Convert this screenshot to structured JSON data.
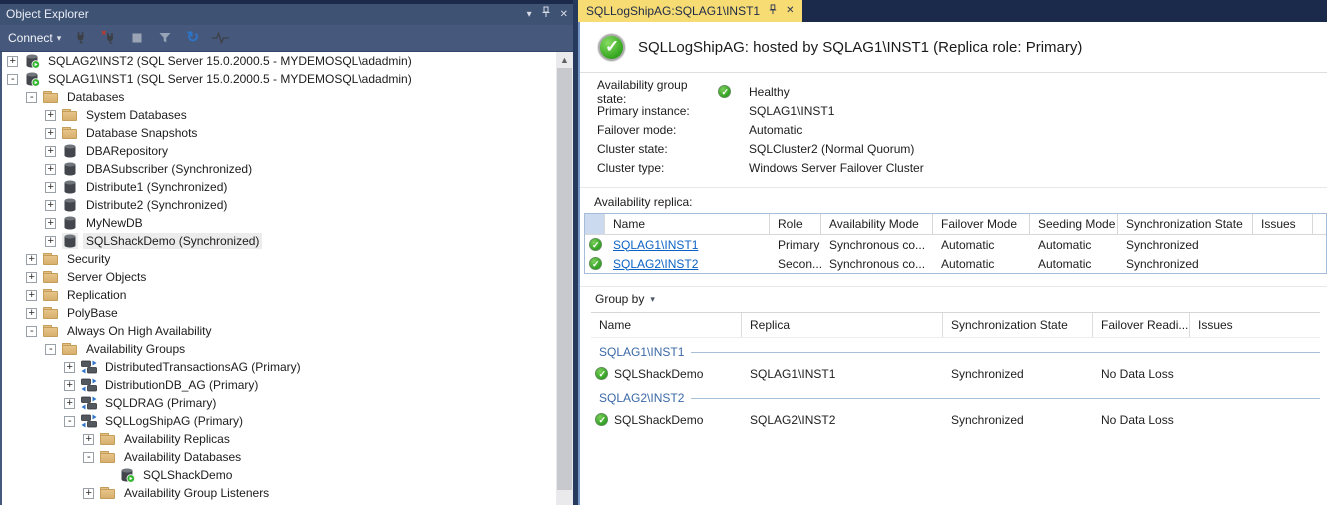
{
  "object_explorer": {
    "title": "Object Explorer",
    "connect_label": "Connect",
    "tree": [
      {
        "label": "SQLAG2\\INST2 (SQL Server 15.0.2000.5 - MYDEMOSQL\\adadmin)"
      },
      {
        "label": "SQLAG1\\INST1 (SQL Server 15.0.2000.5 - MYDEMOSQL\\adadmin)"
      },
      {
        "label": "Databases"
      },
      {
        "label": "System Databases"
      },
      {
        "label": "Database Snapshots"
      },
      {
        "label": "DBARepository"
      },
      {
        "label": "DBASubscriber (Synchronized)"
      },
      {
        "label": "Distribute1 (Synchronized)"
      },
      {
        "label": "Distribute2 (Synchronized)"
      },
      {
        "label": "MyNewDB"
      },
      {
        "label": "SQLShackDemo (Synchronized)",
        "selected": true
      },
      {
        "label": "Security"
      },
      {
        "label": "Server Objects"
      },
      {
        "label": "Replication"
      },
      {
        "label": "PolyBase"
      },
      {
        "label": "Always On High Availability"
      },
      {
        "label": "Availability Groups"
      },
      {
        "label": "DistributedTransactionsAG (Primary)"
      },
      {
        "label": "DistributionDB_AG (Primary)"
      },
      {
        "label": "SQLDRAG (Primary)"
      },
      {
        "label": "SQLLogShipAG (Primary)"
      },
      {
        "label": "Availability Replicas"
      },
      {
        "label": "Availability Databases"
      },
      {
        "label": "SQLShackDemo"
      },
      {
        "label": "Availability Group Listeners"
      }
    ]
  },
  "tab": {
    "title": "SQLLogShipAG:SQLAG1\\INST1"
  },
  "dashboard": {
    "header_title": "SQLLogShipAG: hosted by SQLAG1\\INST1 (Replica role: Primary)",
    "details": [
      {
        "label": "Availability group state:",
        "value": "Healthy"
      },
      {
        "label": "Primary instance:",
        "value": "SQLAG1\\INST1"
      },
      {
        "label": "Failover mode:",
        "value": "Automatic"
      },
      {
        "label": "Cluster state:",
        "value": "SQLCluster2 (Normal Quorum)"
      },
      {
        "label": "Cluster type:",
        "value": "Windows Server Failover Cluster"
      }
    ],
    "replica": {
      "section_label": "Availability replica:",
      "columns": [
        "Name",
        "Role",
        "Availability Mode",
        "Failover Mode",
        "Seeding Mode",
        "Synchronization State",
        "Issues"
      ],
      "rows": [
        {
          "name": "SQLAG1\\INST1",
          "role": "Primary",
          "availability_mode": "Synchronous co...",
          "failover_mode": "Automatic",
          "seeding_mode": "Automatic",
          "synchronization_state": "Synchronized",
          "issues": ""
        },
        {
          "name": "SQLAG2\\INST2",
          "role": "Secon...",
          "availability_mode": "Synchronous co...",
          "failover_mode": "Automatic",
          "seeding_mode": "Automatic",
          "synchronization_state": "Synchronized",
          "issues": ""
        }
      ]
    },
    "databases": {
      "group_by_label": "Group by",
      "columns": [
        "Name",
        "Replica",
        "Synchronization State",
        "Failover Readi...",
        "Issues"
      ],
      "groups": [
        {
          "header": "SQLAG1\\INST1",
          "rows": [
            {
              "name": "SQLShackDemo",
              "replica": "SQLAG1\\INST1",
              "synchronization_state": "Synchronized",
              "failover_readiness": "No Data Loss",
              "issues": ""
            }
          ]
        },
        {
          "header": "SQLAG2\\INST2",
          "rows": [
            {
              "name": "SQLShackDemo",
              "replica": "SQLAG2\\INST2",
              "synchronization_state": "Synchronized",
              "failover_readiness": "No Data Loss",
              "issues": ""
            }
          ]
        }
      ]
    }
  },
  "icons": {
    "status_ok": "green-circle-white-check",
    "server": "database-cylinder-green-play-badge",
    "database": "dark-cylinder",
    "availability_group": "two-servers-blue-sync-arrows",
    "folder": "tan-folder",
    "toolbar": [
      "connect-plug",
      "disconnect-plug-red-x",
      "stop-disabled",
      "filter-funnel",
      "refresh-circular-arrow",
      "activity-monitor-pulse"
    ]
  },
  "colors": {
    "titlebar": "#3E5273",
    "toolbar": "#46597C",
    "frame": "#1B2A4A",
    "tab_active": "#F7DC74",
    "status_green": "#2FA21B",
    "link_blue": "#0B62C4",
    "group_header_blue": "#3A69A6",
    "grid_border": "#A6BCDB",
    "selection_gray": "#ECECEC"
  }
}
